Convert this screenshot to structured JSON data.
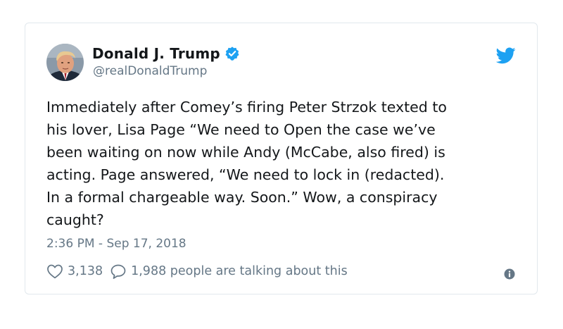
{
  "author": {
    "display_name": "Donald J. Trump",
    "handle": "@realDonaldTrump",
    "verified": true
  },
  "tweet": {
    "lines": [
      "Immediately after Comey’s firing Peter Strzok texted to",
      "his lover, Lisa Page “We need to Open the case we’ve",
      "been waiting on now while Andy (McCabe, also fired) is",
      "acting. Page answered, “We need to lock in (redacted).",
      "In a formal chargeable way. Soon.” Wow, a conspiracy",
      "caught?"
    ],
    "timestamp": "2:36 PM - Sep 17, 2018"
  },
  "actions": {
    "likes": "3,138",
    "talking": "1,988 people are talking about this"
  },
  "icons": {
    "bird": "twitter-bird-icon",
    "verified": "verified-badge-icon",
    "like": "heart-icon",
    "reply": "speech-bubble-icon",
    "info": "info-icon"
  },
  "colors": {
    "brand_blue": "#1da1f2",
    "text": "#14171a",
    "muted": "#657786",
    "border": "#e1e8ed"
  }
}
